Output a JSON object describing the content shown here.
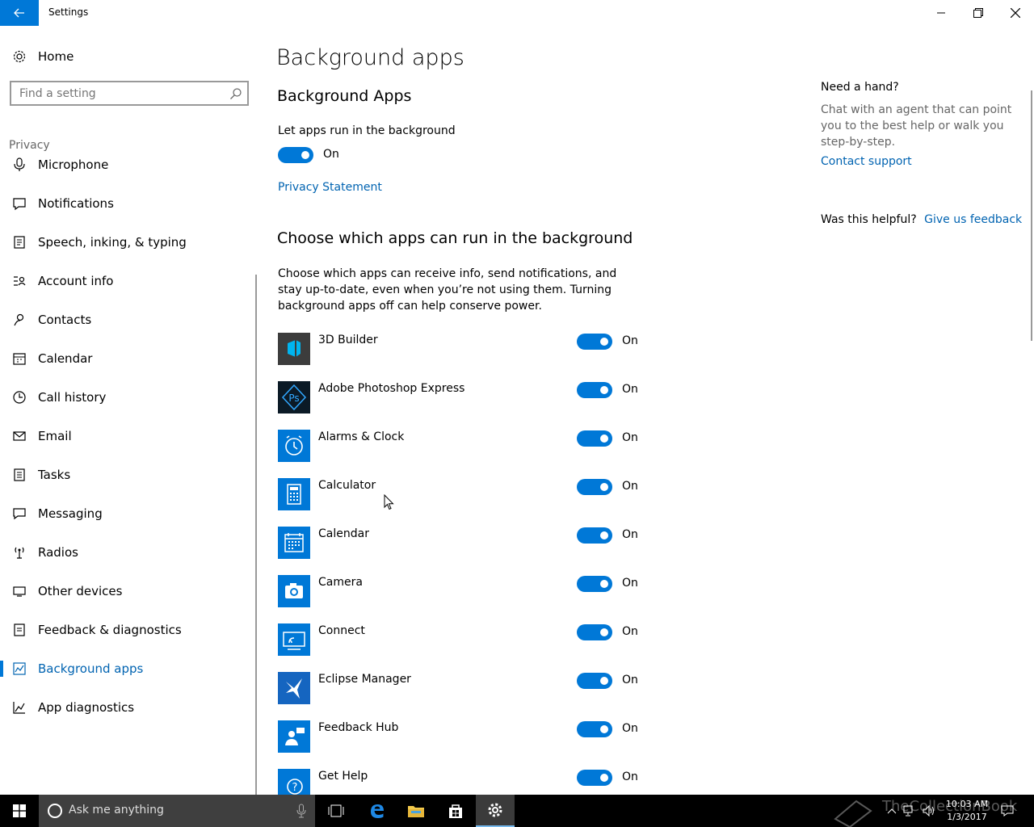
{
  "window": {
    "title": "Settings",
    "accent": "#0078d7"
  },
  "sidebar": {
    "home_label": "Home",
    "search_placeholder": "Find a setting",
    "section": "Privacy",
    "items": [
      {
        "label": "Microphone",
        "icon": "microphone-icon"
      },
      {
        "label": "Notifications",
        "icon": "notifications-icon"
      },
      {
        "label": "Speech, inking, & typing",
        "icon": "speech-icon"
      },
      {
        "label": "Account info",
        "icon": "account-info-icon"
      },
      {
        "label": "Contacts",
        "icon": "contacts-icon"
      },
      {
        "label": "Calendar",
        "icon": "calendar-icon"
      },
      {
        "label": "Call history",
        "icon": "call-history-icon"
      },
      {
        "label": "Email",
        "icon": "email-icon"
      },
      {
        "label": "Tasks",
        "icon": "tasks-icon"
      },
      {
        "label": "Messaging",
        "icon": "messaging-icon"
      },
      {
        "label": "Radios",
        "icon": "radios-icon"
      },
      {
        "label": "Other devices",
        "icon": "other-devices-icon"
      },
      {
        "label": "Feedback & diagnostics",
        "icon": "feedback-icon"
      },
      {
        "label": "Background apps",
        "icon": "background-apps-icon",
        "selected": true
      },
      {
        "label": "App diagnostics",
        "icon": "app-diagnostics-icon"
      }
    ]
  },
  "main": {
    "page_title": "Background apps",
    "section1_title": "Background Apps",
    "let_apps_label": "Let apps run in the background",
    "master_toggle_state": "On",
    "privacy_link": "Privacy Statement",
    "section2_title": "Choose which apps can run in the background",
    "description": "Choose which apps can receive info, send notifications, and stay up-to-date, even when you’re not using them. Turning background apps off can help conserve power.",
    "apps": [
      {
        "name": "3D Builder",
        "state": "On",
        "icon": "3d-builder-icon",
        "icon_bg": "#3c3c3c"
      },
      {
        "name": "Adobe Photoshop Express",
        "state": "On",
        "icon": "photoshop-express-icon",
        "icon_bg": "#0b1a26"
      },
      {
        "name": "Alarms & Clock",
        "state": "On",
        "icon": "alarm-clock-icon",
        "icon_bg": "#0078d7"
      },
      {
        "name": "Calculator",
        "state": "On",
        "icon": "calculator-icon",
        "icon_bg": "#0078d7"
      },
      {
        "name": "Calendar",
        "state": "On",
        "icon": "calendar-app-icon",
        "icon_bg": "#0078d7"
      },
      {
        "name": "Camera",
        "state": "On",
        "icon": "camera-icon",
        "icon_bg": "#0078d7"
      },
      {
        "name": "Connect",
        "state": "On",
        "icon": "connect-icon",
        "icon_bg": "#0078d7"
      },
      {
        "name": "Eclipse Manager",
        "state": "On",
        "icon": "eclipse-manager-icon",
        "icon_bg": "#1565c0"
      },
      {
        "name": "Feedback Hub",
        "state": "On",
        "icon": "feedback-hub-icon",
        "icon_bg": "#0078d7"
      },
      {
        "name": "Get Help",
        "state": "On",
        "icon": "get-help-icon",
        "icon_bg": "#0078d7"
      }
    ]
  },
  "help": {
    "title": "Need a hand?",
    "text": "Chat with an agent that can point you to the best help or walk you step-by-step.",
    "contact_link": "Contact support",
    "helpful_question": "Was this helpful?",
    "feedback_link": "Give us feedback"
  },
  "taskbar": {
    "search_placeholder": "Ask me anything",
    "time": "10:03 AM",
    "date": "1/3/2017",
    "watermark": "TheCollectionBook"
  }
}
